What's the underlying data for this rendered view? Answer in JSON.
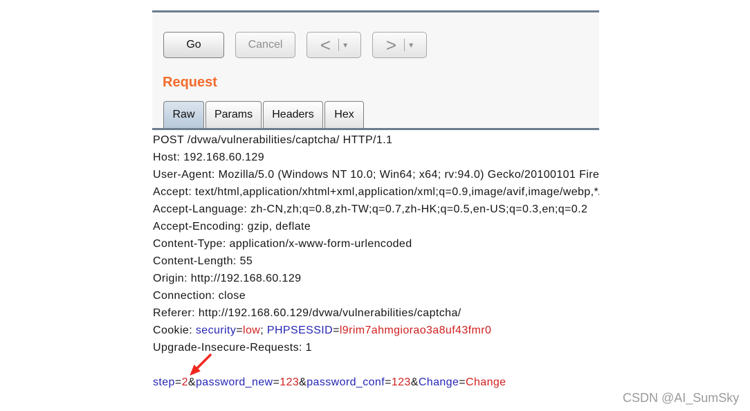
{
  "toolbar": {
    "go_label": "Go",
    "cancel_label": "Cancel",
    "back_icon": "chevron-left-icon",
    "back_glyph": "<",
    "forward_icon": "chevron-right-icon",
    "forward_glyph": ">",
    "dropdown_icon": "caret-down-icon",
    "dropdown_glyph": "▾"
  },
  "panel_title": "Request",
  "tabs": [
    {
      "label": "Raw",
      "selected": true
    },
    {
      "label": "Params",
      "selected": false
    },
    {
      "label": "Headers",
      "selected": false
    },
    {
      "label": "Hex",
      "selected": false
    }
  ],
  "request": {
    "request_line": "POST /dvwa/vulnerabilities/captcha/ HTTP/1.1",
    "headers_before_cookie": [
      "Host: 192.168.60.129",
      "User-Agent: Mozilla/5.0 (Windows NT 10.0; Win64; x64; rv:94.0) Gecko/20100101 Fire",
      "Accept: text/html,application/xhtml+xml,application/xml;q=0.9,image/avif,image/webp,*/",
      "Accept-Language: zh-CN,zh;q=0.8,zh-TW;q=0.7,zh-HK;q=0.5,en-US;q=0.3,en;q=0.2",
      "Accept-Encoding: gzip, deflate",
      "Content-Type: application/x-www-form-urlencoded",
      "Content-Length: 55",
      "Origin: http://192.168.60.129",
      "Connection: close",
      "Referer: http://192.168.60.129/dvwa/vulnerabilities/captcha/"
    ],
    "cookie": {
      "label": "Cookie: ",
      "assign": "=",
      "separator": "; ",
      "pairs": [
        {
          "name": "security",
          "value": "low"
        },
        {
          "name": "PHPSESSID",
          "value": "l9rim7ahmgiorao3a8uf43fmr0"
        }
      ]
    },
    "headers_after_cookie": [
      "Upgrade-Insecure-Requests: 1"
    ],
    "body": {
      "assign": "=",
      "separator": "&",
      "params": [
        {
          "name": "step",
          "value": "2"
        },
        {
          "name": "password_new",
          "value": "123"
        },
        {
          "name": "password_conf",
          "value": "123"
        },
        {
          "name": "Change",
          "value": "Change"
        }
      ]
    }
  },
  "watermark": "CSDN @AI_SumSky",
  "colors": {
    "title_accent": "#f36b2b",
    "param_name": "#2626b5",
    "param_value": "#d11f1f",
    "annotation_arrow": "#f0281e",
    "rule": "#6c7d8e",
    "selected_tab": "#b8c9da"
  }
}
